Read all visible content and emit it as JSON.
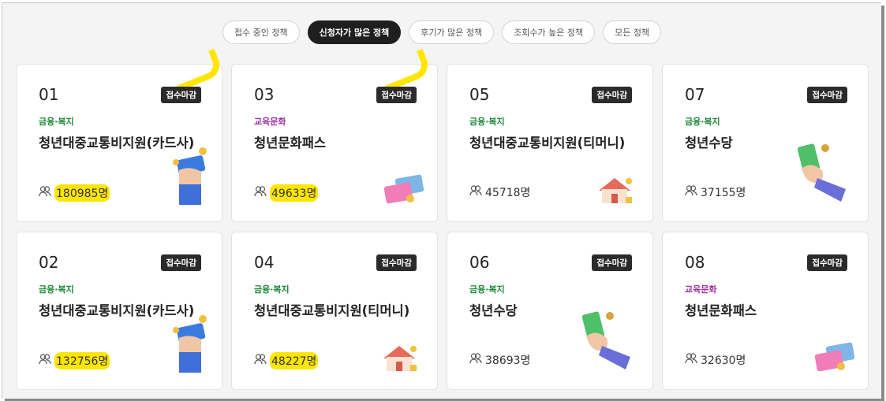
{
  "tabs": [
    {
      "label": "접수 중인 정책",
      "active": false
    },
    {
      "label": "신청자가 많은 정책",
      "active": true
    },
    {
      "label": "후기가 많은 정책",
      "active": false
    },
    {
      "label": "조회수가 높은 정책",
      "active": false
    },
    {
      "label": "모든 정책",
      "active": false
    }
  ],
  "cards": [
    {
      "num": "01",
      "badge": "접수마감",
      "category": "금융·복지",
      "title": "청년대중교통비지원(카드사)",
      "count": "180985명",
      "illustration": "hand-card-icon"
    },
    {
      "num": "03",
      "badge": "접수마감",
      "category": "교육문화",
      "title": "청년문화패스",
      "count": "49633명",
      "illustration": "credit-cards-icon"
    },
    {
      "num": "05",
      "badge": "접수마감",
      "category": "금융·복지",
      "title": "청년대중교통비지원(티머니)",
      "count": "45718명",
      "illustration": "house-icon"
    },
    {
      "num": "07",
      "badge": "접수마감",
      "category": "금융·복지",
      "title": "청년수당",
      "count": "37155명",
      "illustration": "hand-money-icon"
    },
    {
      "num": "02",
      "badge": "접수마감",
      "category": "금융·복지",
      "title": "청년대중교통비지원(카드사)",
      "count": "132756명",
      "illustration": "hand-card-icon"
    },
    {
      "num": "04",
      "badge": "접수마감",
      "category": "금융·복지",
      "title": "청년대중교통비지원(티머니)",
      "count": "48227명",
      "illustration": "house-icon"
    },
    {
      "num": "06",
      "badge": "접수마감",
      "category": "금융·복지",
      "title": "청년수당",
      "count": "38693명",
      "illustration": "hand-money-icon"
    },
    {
      "num": "08",
      "badge": "접수마감",
      "category": "교육문화",
      "title": "청년문화패스",
      "count": "32630명",
      "illustration": "credit-cards-icon"
    }
  ],
  "colors": {
    "highlight": "#ffe600",
    "finance": "#1e8a3a",
    "culture": "#a232a8",
    "badge": "#2b2b2b"
  }
}
